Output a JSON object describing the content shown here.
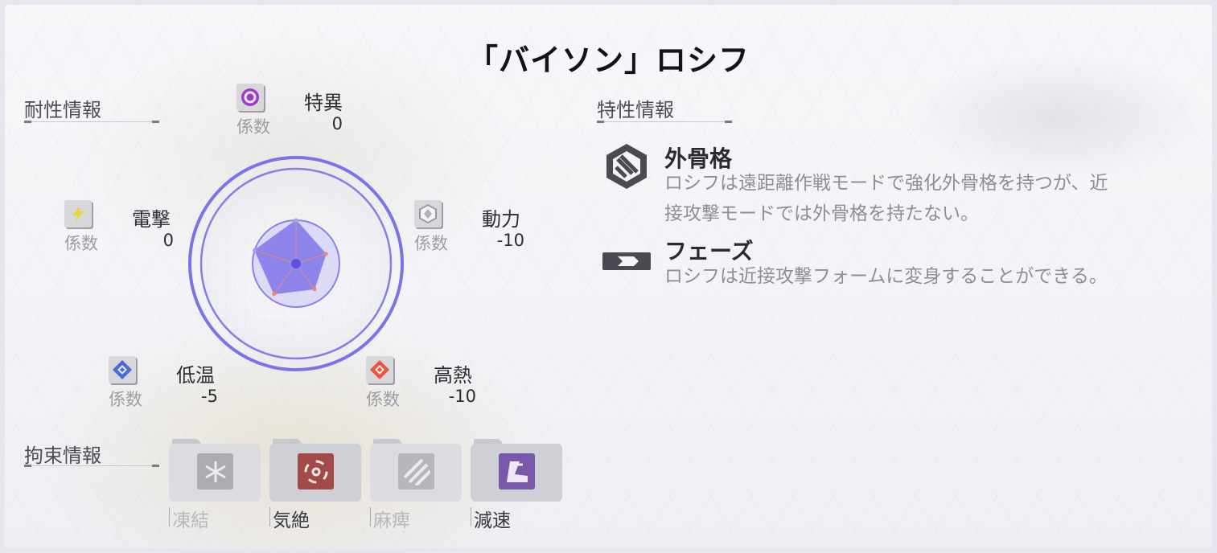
{
  "title": "「バイソン」ロシフ",
  "resistance": {
    "heading": "耐性情報",
    "coef_label": "係数",
    "items": [
      {
        "key": "anomaly",
        "name": "特異",
        "value": "0",
        "icon": "anomaly-target-icon",
        "color": "#9a3cc8"
      },
      {
        "key": "electric",
        "name": "電撃",
        "value": "0",
        "icon": "lightning-icon",
        "color": "#e5d835"
      },
      {
        "key": "physical",
        "name": "動力",
        "value": "-10",
        "icon": "physical-hex-icon",
        "color": "#b0b0b6"
      },
      {
        "key": "cold",
        "name": "低温",
        "value": "-5",
        "icon": "ice-diamond-icon",
        "color": "#4a6ad8"
      },
      {
        "key": "heat",
        "name": "高熱",
        "value": "-10",
        "icon": "fire-diamond-icon",
        "color": "#e8553e"
      }
    ]
  },
  "traits": {
    "heading": "特性情報",
    "items": [
      {
        "name": "外骨格",
        "desc_line1": "ロシフは遠距離作戦モードで強化外骨格を持つが、近",
        "desc_line2": "接攻撃モードでは外骨格を持たない。",
        "icon": "exoskeleton-shield-icon"
      },
      {
        "name": "フェーズ",
        "desc_line1": "ロシフは近接攻撃フォームに変身することができる。",
        "icon": "phase-arrow-icon"
      }
    ]
  },
  "restraint": {
    "heading": "拘束情報",
    "items": [
      {
        "label": "凍結",
        "active": false,
        "icon": "freeze-snowflake-icon",
        "color": "#ababb0"
      },
      {
        "label": "気絶",
        "active": true,
        "icon": "stun-spiral-icon",
        "color": "#a24a4a"
      },
      {
        "label": "麻痺",
        "active": false,
        "icon": "paralysis-stripes-icon",
        "color": "#b5b5ba"
      },
      {
        "label": "減速",
        "active": true,
        "icon": "slow-boot-icon",
        "color": "#7a58a8"
      }
    ]
  }
}
